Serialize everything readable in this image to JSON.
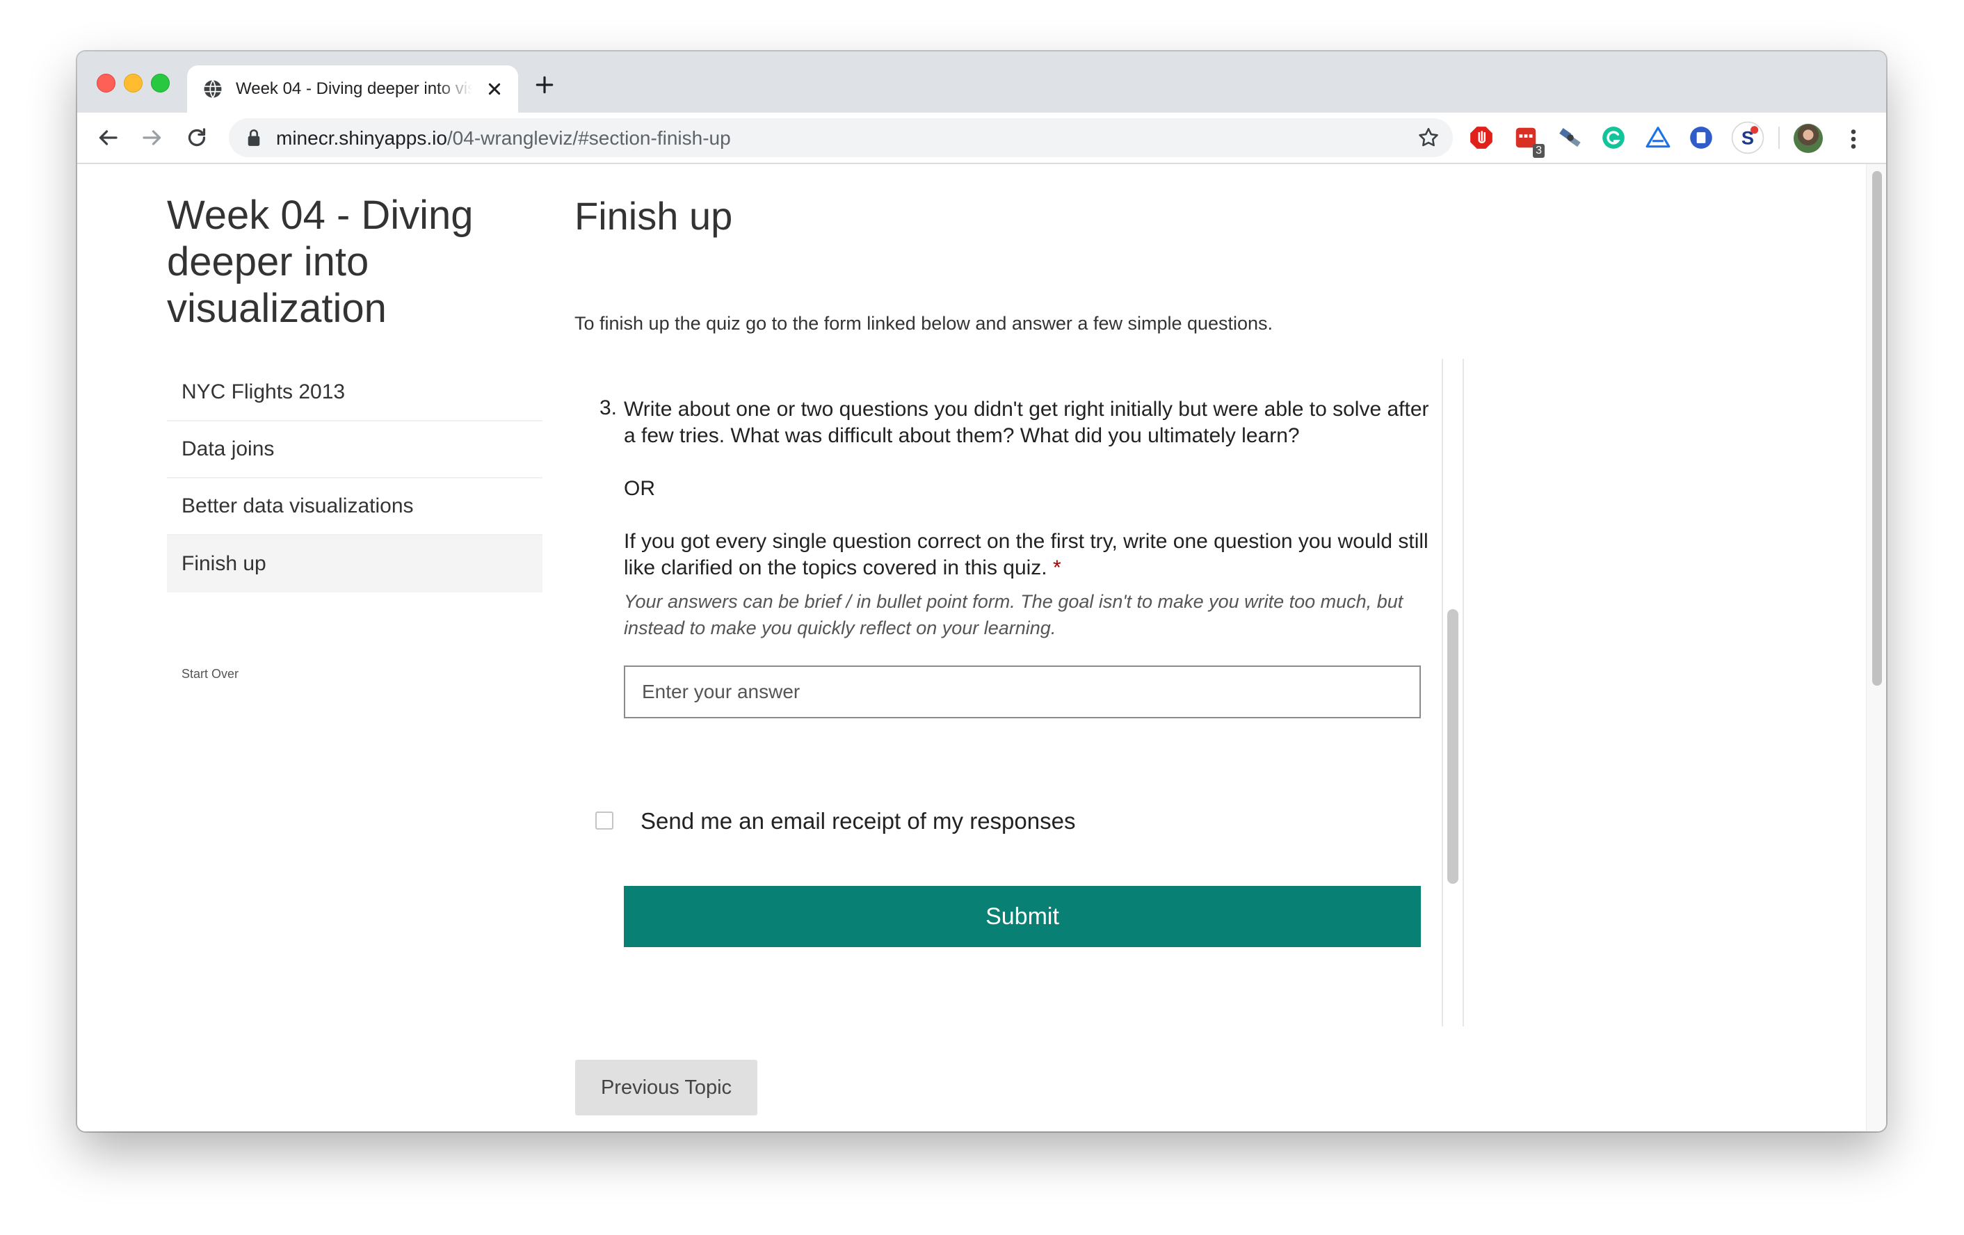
{
  "browser": {
    "tab_title": "Week 04 - Diving deeper into visualization",
    "url_host": "minecr.shinyapps.io",
    "url_path": "/04-wrangleviz/#section-finish-up",
    "extensions": [
      "adblock-icon",
      "calendar-extension-icon",
      "satellite-extension-icon",
      "grammarly-icon",
      "drive-extension-icon",
      "docs-extension-icon",
      "sidekick-extension-icon"
    ],
    "calendar_badge": "3",
    "colors": {
      "tabbar": "#dee1e6",
      "omnibox": "#f1f3f4"
    }
  },
  "sidebar": {
    "title": "Week 04 - Diving deeper into visualization",
    "items": [
      {
        "label": "NYC Flights 2013",
        "active": false
      },
      {
        "label": "Data joins",
        "active": false
      },
      {
        "label": "Better data visualizations",
        "active": false
      },
      {
        "label": "Finish up",
        "active": true
      }
    ],
    "start_over": "Start Over"
  },
  "main": {
    "title": "Finish up",
    "intro": "To finish up the quiz go to the form linked below and answer a few simple questions."
  },
  "form": {
    "question_number": "3.",
    "question_para1": "Write about one or two questions you didn't get right initially but were able to solve after a few tries. What was difficult about them? What did you ultimately learn?",
    "question_para2": "OR",
    "question_para3": "If you got every single question correct on the first try, write one question you would still like clarified on the topics covered in this quiz.",
    "required_mark": "*",
    "hint": "Your answers can be brief / in bullet point form. The goal isn't to make you write too much, but instead to make you quickly reflect on your learning.",
    "answer_placeholder": "Enter your answer",
    "answer_value": "",
    "receipt_label": "Send me an email receipt of my responses",
    "receipt_checked": false,
    "submit_label": "Submit",
    "colors": {
      "submit": "#088074",
      "required": "#a80000"
    }
  },
  "footer": {
    "prev_topic": "Previous Topic"
  }
}
